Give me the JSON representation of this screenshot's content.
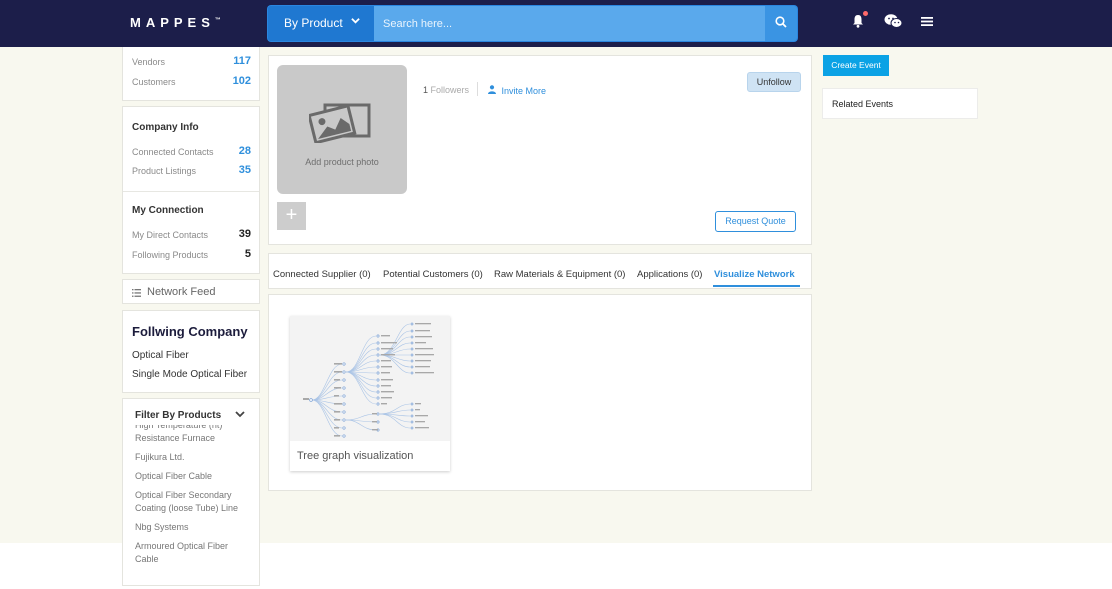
{
  "header": {
    "logo": "MAPPES",
    "logo_mark": "™",
    "search": {
      "category": "By Product",
      "placeholder": "Search here..."
    }
  },
  "sidebar": {
    "stats": [
      {
        "label": "Vendors",
        "value": "117"
      },
      {
        "label": "Customers",
        "value": "102"
      }
    ],
    "company_info": {
      "title": "Company Info",
      "rows": [
        {
          "label": "Connected Contacts",
          "value": "28"
        },
        {
          "label": "Product Listings",
          "value": "35"
        }
      ]
    },
    "my_connection": {
      "title": "My Connection",
      "rows": [
        {
          "label": "My Direct Contacts",
          "value": "39"
        },
        {
          "label": "Following Products",
          "value": "5"
        }
      ]
    },
    "network_feed": "Network Feed",
    "following_company": {
      "title": "Follwing Company",
      "items": [
        "Optical Fiber",
        "Single Mode Optical Fiber"
      ]
    },
    "filter": {
      "title": "Filter By Products",
      "items": [
        "High Temperature (ht) Resistance Furnace",
        "Fujikura Ltd.",
        "Optical Fiber Cable",
        "Optical Fiber Secondary Coating (loose Tube) Line",
        "Nbg Systems",
        "Armoured Optical Fiber Cable"
      ]
    }
  },
  "product": {
    "photo_label": "Add product photo",
    "add_symbol": "+",
    "followers_count": "1",
    "followers_label": "Followers",
    "invite_label": "Invite More",
    "unfollow_label": "Unfollow",
    "request_quote_label": "Request Quote"
  },
  "tabs": [
    {
      "label": "Connected Supplier (0)",
      "active": false
    },
    {
      "label": "Potential Customers (0)",
      "active": false
    },
    {
      "label": "Raw Materials & Equipment (0)",
      "active": false
    },
    {
      "label": "Applications (0)",
      "active": false
    },
    {
      "label": "Visualize Network",
      "active": true
    }
  ],
  "visualization": {
    "label": "Tree graph visualization"
  },
  "right": {
    "create_event": "Create Event",
    "related_events": "Related Events"
  },
  "colors": {
    "header_bg": "#1c1e4a",
    "accent": "#2f8fdc",
    "search_bg": "#1f78d1",
    "create_event_bg": "#0ba2e5",
    "page_bg": "#f8f8ef"
  }
}
